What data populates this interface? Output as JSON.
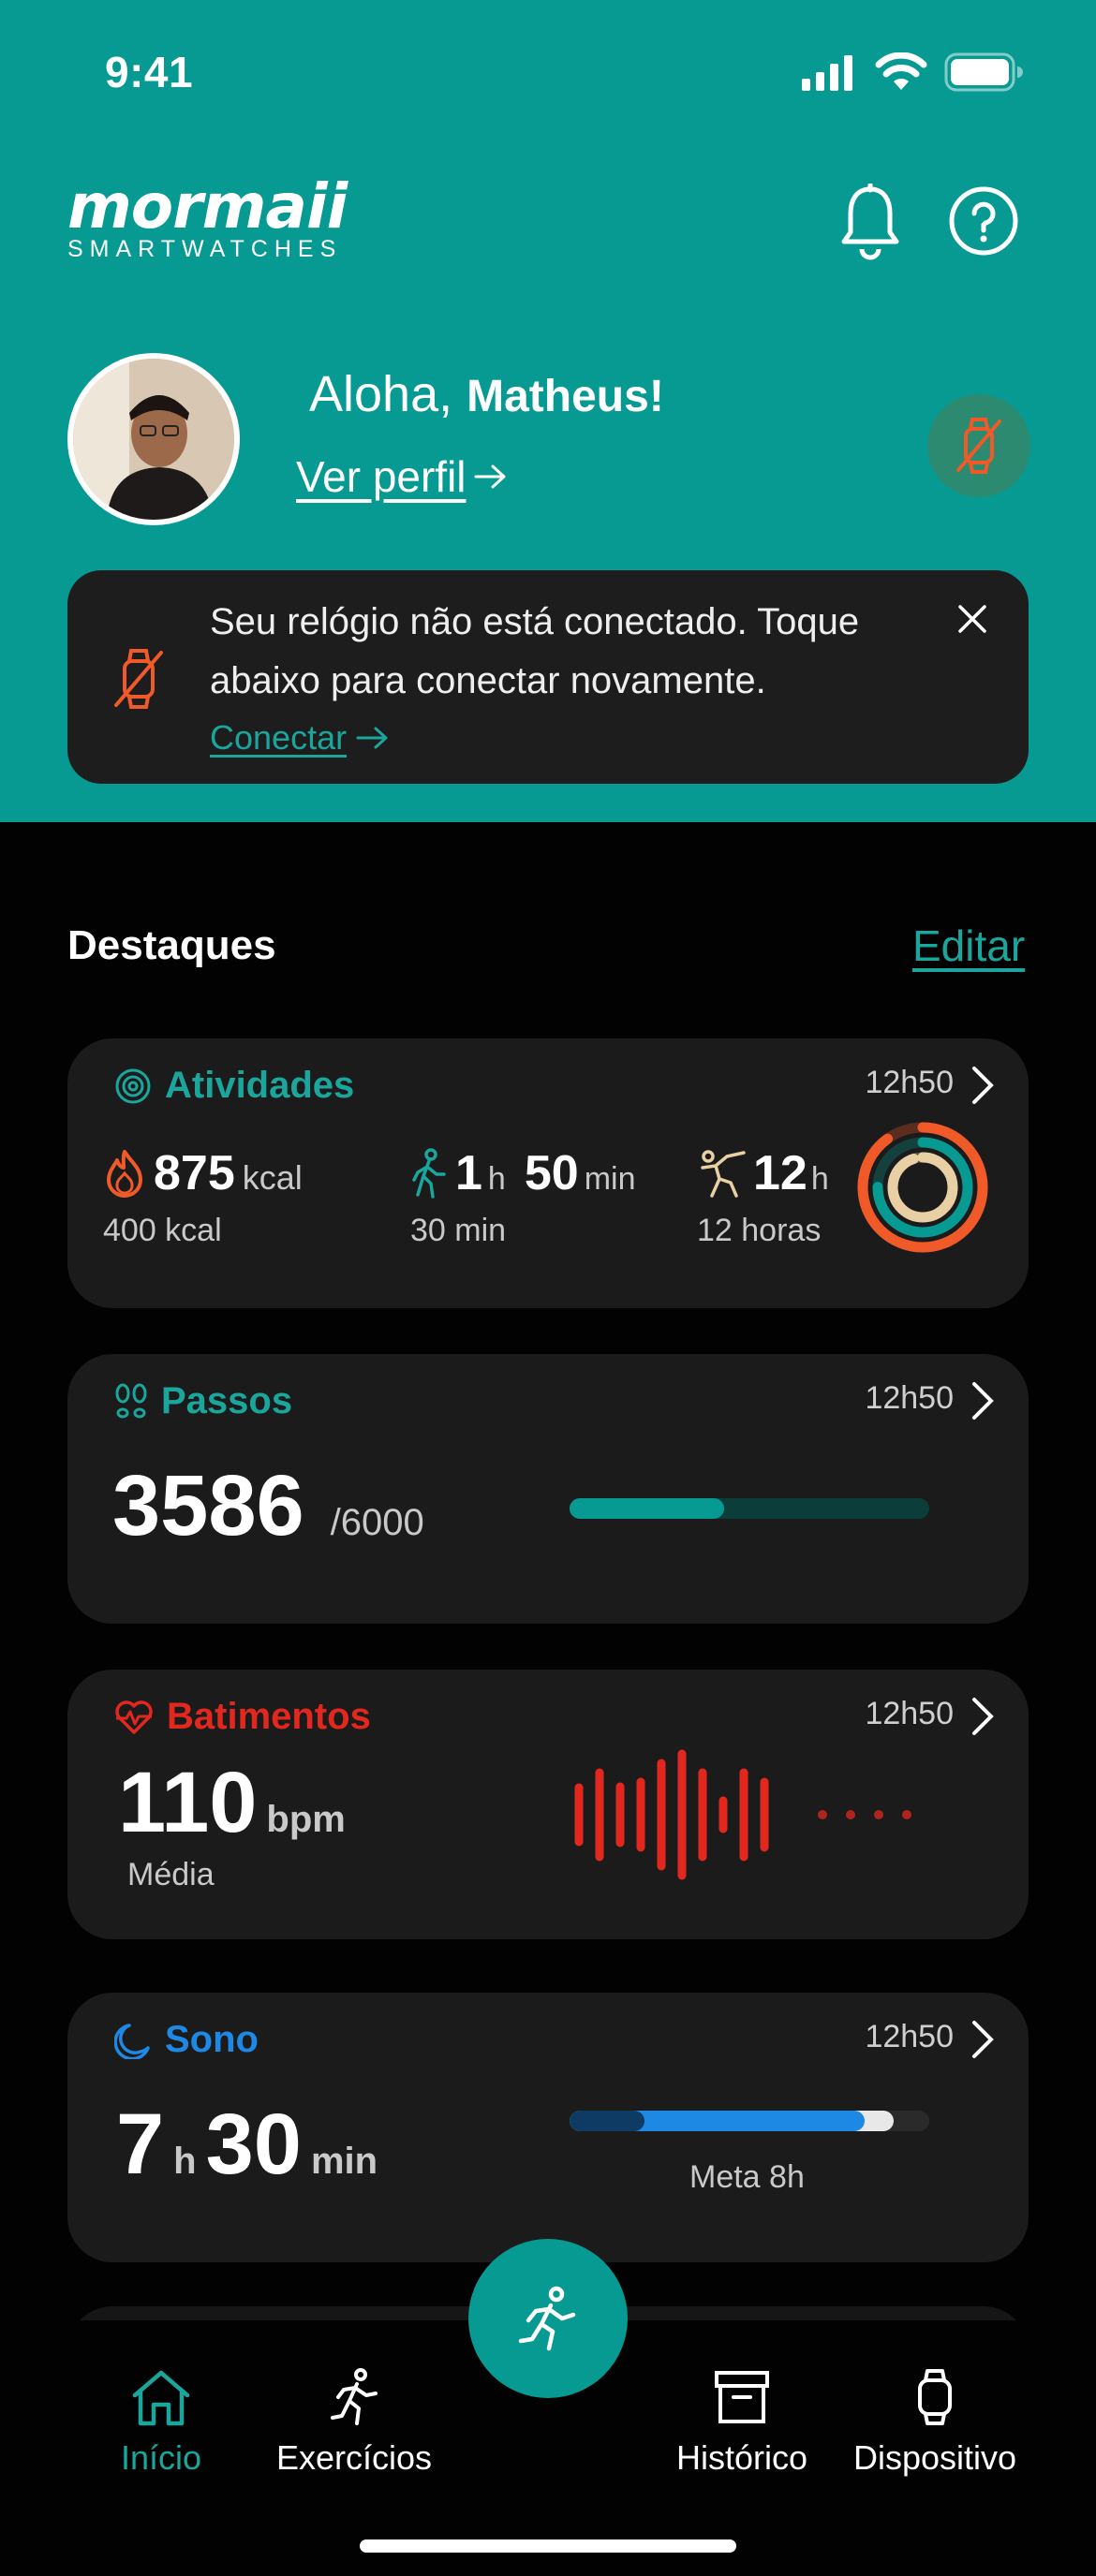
{
  "status_bar": {
    "time": "9:41"
  },
  "header": {
    "brand_main": "mormaii",
    "brand_sub": "SMARTWATCHES",
    "greeting_prefix": "Aloha, ",
    "greeting_name": "Matheus!",
    "profile_link": "Ver perfil",
    "notification_icon": "bell-icon",
    "help_icon": "help-icon"
  },
  "banner": {
    "message": "Seu relógio não está conectado. Toque abaixo para conectar novamente.",
    "connect_link": "Conectar",
    "accent_color": "#f05a28"
  },
  "highlights": {
    "title": "Destaques",
    "edit_label": "Editar"
  },
  "cards": {
    "activities": {
      "title": "Atividades",
      "time": "12h50",
      "calories_value": "875",
      "calories_unit": "kcal",
      "calories_goal": "400 kcal",
      "exercise_hours": "1",
      "exercise_h_unit": "h",
      "exercise_minutes": "50",
      "exercise_min_unit": "min",
      "exercise_goal": "30 min",
      "stand_value": "12",
      "stand_unit": "h",
      "stand_goal": "12 horas",
      "rings": {
        "move": 0.9,
        "exercise": 0.75,
        "stand": 0.95
      },
      "colors": {
        "move": "#f05a28",
        "exercise": "#079a92",
        "stand": "#e8cfa4"
      }
    },
    "steps": {
      "title": "Passos",
      "time": "12h50",
      "value": "3586",
      "goal": "/6000",
      "progress": 0.43,
      "color": "#079a92"
    },
    "heart": {
      "title": "Batimentos",
      "time": "12h50",
      "value": "110",
      "unit": "bpm",
      "label": "Média",
      "color": "#e2281e"
    },
    "sleep": {
      "title": "Sono",
      "time": "12h50",
      "hours": "7",
      "h_unit": "h",
      "minutes": "30",
      "min_unit": "min",
      "goal_label": "Meta 8h",
      "progress": 0.9,
      "color": "#1e88e5"
    }
  },
  "nav": {
    "items": [
      {
        "label": "Início",
        "icon": "home-icon",
        "active": true
      },
      {
        "label": "Exercícios",
        "icon": "running-icon",
        "active": false
      },
      {
        "label": "Histórico",
        "icon": "archive-icon",
        "active": false
      },
      {
        "label": "Dispositivo",
        "icon": "watch-icon",
        "active": false
      }
    ],
    "fab_icon": "running-icon"
  }
}
